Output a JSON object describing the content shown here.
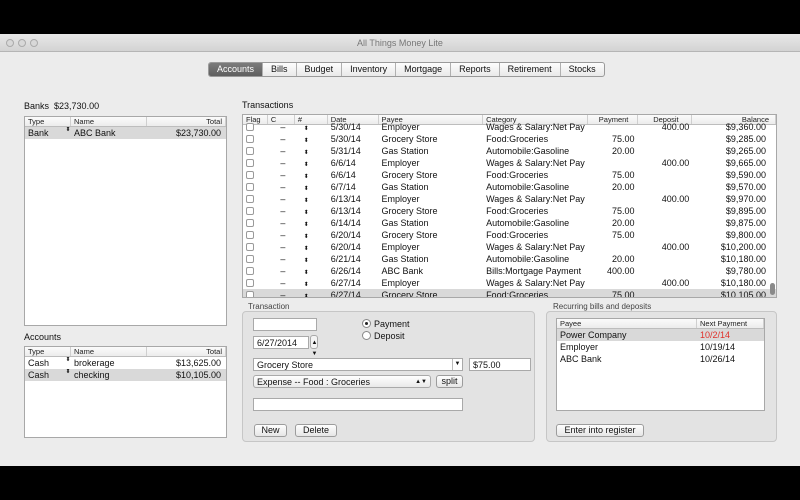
{
  "window": {
    "title": "All Things Money Lite"
  },
  "tabs": [
    {
      "label": "Accounts",
      "active": true
    },
    {
      "label": "Bills",
      "active": false
    },
    {
      "label": "Budget",
      "active": false
    },
    {
      "label": "Inventory",
      "active": false
    },
    {
      "label": "Mortgage",
      "active": false
    },
    {
      "label": "Reports",
      "active": false
    },
    {
      "label": "Retirement",
      "active": false
    },
    {
      "label": "Stocks",
      "active": false
    }
  ],
  "banks": {
    "label": "Banks",
    "total": "$23,730.00",
    "columns": [
      "Type",
      "Name",
      "Total"
    ],
    "rows": [
      {
        "type": "Bank",
        "name": "ABC Bank",
        "total": "$23,730.00"
      }
    ]
  },
  "accounts": {
    "label": "Accounts",
    "columns": [
      "Type",
      "Name",
      "Total"
    ],
    "rows": [
      {
        "type": "Cash",
        "name": "brokerage",
        "total": "$13,625.00"
      },
      {
        "type": "Cash",
        "name": "checking",
        "total": "$10,105.00"
      }
    ]
  },
  "transactions": {
    "label": "Transactions",
    "columns": [
      "Flag",
      "C",
      "#",
      "Date",
      "Payee",
      "Category",
      "Payment",
      "Deposit",
      "Balance"
    ],
    "rows": [
      {
        "c": "–",
        "date": "5/30/14",
        "payee": "Employer",
        "category": "Wages & Salary:Net Pay",
        "payment": "",
        "deposit": "400.00",
        "balance": "$9,360.00"
      },
      {
        "c": "–",
        "date": "5/30/14",
        "payee": "Grocery Store",
        "category": "Food:Groceries",
        "payment": "75.00",
        "deposit": "",
        "balance": "$9,285.00"
      },
      {
        "c": "–",
        "date": "5/31/14",
        "payee": "Gas Station",
        "category": "Automobile:Gasoline",
        "payment": "20.00",
        "deposit": "",
        "balance": "$9,265.00"
      },
      {
        "c": "–",
        "date": "6/6/14",
        "payee": "Employer",
        "category": "Wages & Salary:Net Pay",
        "payment": "",
        "deposit": "400.00",
        "balance": "$9,665.00"
      },
      {
        "c": "–",
        "date": "6/6/14",
        "payee": "Grocery Store",
        "category": "Food:Groceries",
        "payment": "75.00",
        "deposit": "",
        "balance": "$9,590.00"
      },
      {
        "c": "–",
        "date": "6/7/14",
        "payee": "Gas Station",
        "category": "Automobile:Gasoline",
        "payment": "20.00",
        "deposit": "",
        "balance": "$9,570.00"
      },
      {
        "c": "–",
        "date": "6/13/14",
        "payee": "Employer",
        "category": "Wages & Salary:Net Pay",
        "payment": "",
        "deposit": "400.00",
        "balance": "$9,970.00"
      },
      {
        "c": "–",
        "date": "6/13/14",
        "payee": "Grocery Store",
        "category": "Food:Groceries",
        "payment": "75.00",
        "deposit": "",
        "balance": "$9,895.00"
      },
      {
        "c": "–",
        "date": "6/14/14",
        "payee": "Gas Station",
        "category": "Automobile:Gasoline",
        "payment": "20.00",
        "deposit": "",
        "balance": "$9,875.00"
      },
      {
        "c": "–",
        "date": "6/20/14",
        "payee": "Grocery Store",
        "category": "Food:Groceries",
        "payment": "75.00",
        "deposit": "",
        "balance": "$9,800.00"
      },
      {
        "c": "–",
        "date": "6/20/14",
        "payee": "Employer",
        "category": "Wages & Salary:Net Pay",
        "payment": "",
        "deposit": "400.00",
        "balance": "$10,200.00"
      },
      {
        "c": "–",
        "date": "6/21/14",
        "payee": "Gas Station",
        "category": "Automobile:Gasoline",
        "payment": "20.00",
        "deposit": "",
        "balance": "$10,180.00"
      },
      {
        "c": "–",
        "date": "6/26/14",
        "payee": "ABC Bank",
        "category": "Bills:Mortgage Payment",
        "payment": "400.00",
        "deposit": "",
        "balance": "$9,780.00"
      },
      {
        "c": "–",
        "date": "6/27/14",
        "payee": "Employer",
        "category": "Wages & Salary:Net Pay",
        "payment": "",
        "deposit": "400.00",
        "balance": "$10,180.00"
      },
      {
        "c": "–",
        "date": "6/27/14",
        "payee": "Grocery Store",
        "category": "Food:Groceries",
        "payment": "75.00",
        "deposit": "",
        "balance": "$10,105.00"
      }
    ]
  },
  "transaction_form": {
    "label": "Transaction",
    "number": "",
    "date": "6/27/2014",
    "payment_label": "Payment",
    "deposit_label": "Deposit",
    "payee": "Grocery Store",
    "amount": "$75.00",
    "category": "Expense -- Food : Groceries",
    "split_label": "split",
    "memo": "",
    "new_label": "New",
    "delete_label": "Delete"
  },
  "recurring": {
    "label": "Recurring bills and deposits",
    "columns": [
      "Payee",
      "Next Payment"
    ],
    "rows": [
      {
        "payee": "Power Company",
        "next": "10/2/14",
        "overdue": true
      },
      {
        "payee": "Employer",
        "next": "10/19/14",
        "overdue": false
      },
      {
        "payee": "ABC Bank",
        "next": "10/26/14",
        "overdue": false
      }
    ],
    "enter_label": "Enter into register"
  },
  "colors": {
    "overdue": "#e0302a",
    "selected_tab": "#6a6a6a"
  }
}
